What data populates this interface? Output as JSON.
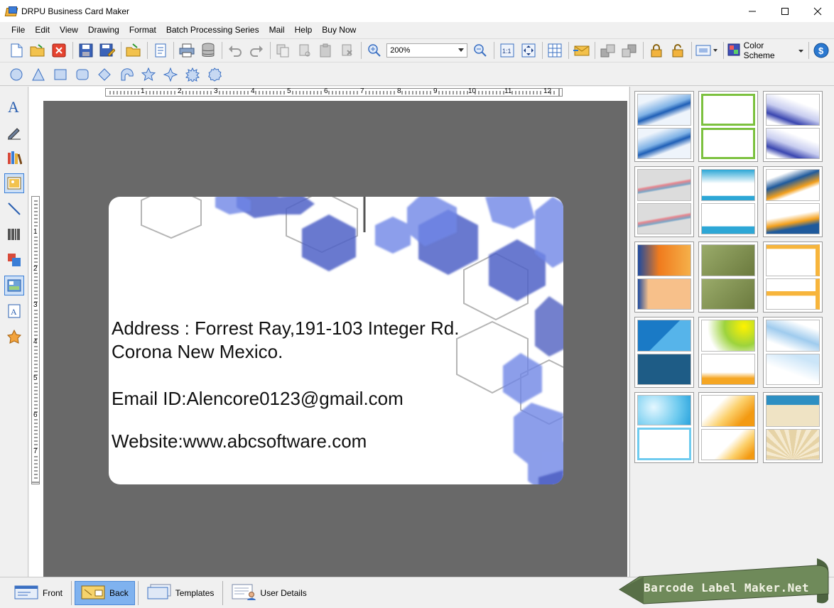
{
  "window": {
    "title": "DRPU Business Card Maker",
    "minimize": "—",
    "maximize": "☐",
    "close": "✕"
  },
  "menu": [
    "File",
    "Edit",
    "View",
    "Drawing",
    "Format",
    "Batch Processing Series",
    "Mail",
    "Help",
    "Buy Now"
  ],
  "toolbar": {
    "zoom_value": "200%",
    "color_scheme_label": "Color Scheme"
  },
  "ruler": {
    "h_labels": [
      "1",
      "2",
      "3",
      "4",
      "5",
      "6",
      "7",
      "8",
      "9",
      "10",
      "11",
      "12"
    ],
    "v_labels": [
      "1",
      "2",
      "3",
      "4",
      "5",
      "6",
      "7"
    ]
  },
  "card": {
    "address_line1": "Address : Forrest Ray,191-103 Integer Rd.",
    "address_line2": "Corona New Mexico.",
    "email": "Email ID:Alencore0123@gmail.com",
    "website": "Website:www.abcsoftware.com"
  },
  "bottom_tabs": {
    "front": "Front",
    "back": "Back",
    "templates": "Templates",
    "user_details": "User Details"
  },
  "banner_text": "Barcode Label Maker.Net",
  "colors": {
    "canvas_gray": "#696969",
    "hex_blue": "#5b6fd6",
    "active_tab": "#7fb2ef",
    "banner_green": "#6f8a5a"
  }
}
